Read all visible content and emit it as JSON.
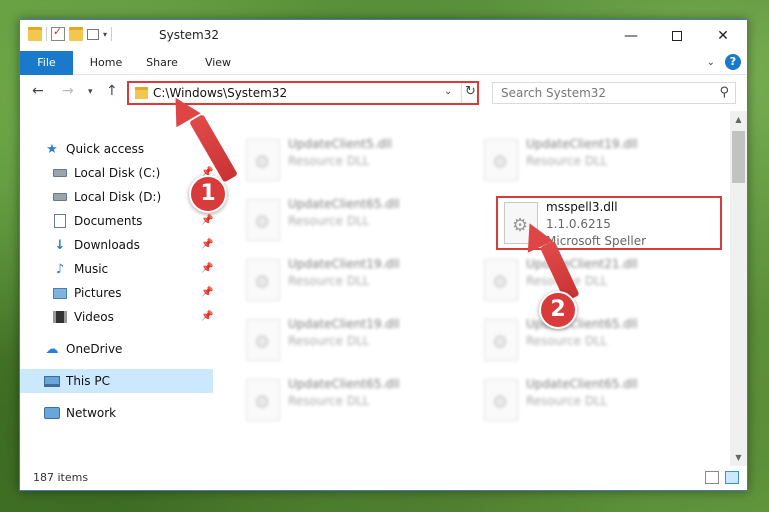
{
  "window": {
    "title": "System32",
    "controls": {
      "minimize": "—",
      "close": "✕"
    }
  },
  "ribbon": {
    "tabs": [
      "File",
      "Home",
      "Share",
      "View"
    ]
  },
  "address": {
    "path": "C:\\Windows\\System32",
    "search_placeholder": "Search System32"
  },
  "nav": {
    "quick_access": "Quick access",
    "items": [
      {
        "label": "Local Disk (C:)",
        "icon": "disk-icon",
        "pinned": true
      },
      {
        "label": "Local Disk (D:)",
        "icon": "disk-icon",
        "pinned": false
      },
      {
        "label": "Documents",
        "icon": "documents-icon",
        "pinned": true
      },
      {
        "label": "Downloads",
        "icon": "download-icon",
        "pinned": true
      },
      {
        "label": "Music",
        "icon": "music-icon",
        "pinned": true
      },
      {
        "label": "Pictures",
        "icon": "pictures-icon",
        "pinned": true
      },
      {
        "label": "Videos",
        "icon": "videos-icon",
        "pinned": true
      }
    ],
    "onedrive": "OneDrive",
    "this_pc": "This PC",
    "network": "Network"
  },
  "files": [
    {
      "name": "UpdateClient5.dll",
      "desc": "Resource DLL"
    },
    {
      "name": "UpdateClient19.dll",
      "desc": "Resource DLL"
    },
    {
      "name": "UpdateClient65.dll",
      "desc": "Resource DLL"
    },
    {
      "name": "msspell3.dll",
      "version": "1.1.0.6215",
      "desc": "Microsoft Speller",
      "highlighted": true
    },
    {
      "name": "UpdateClient19.dll",
      "desc": "Resource DLL"
    },
    {
      "name": "UpdateClient21.dll",
      "desc": "Resource DLL"
    },
    {
      "name": "UpdateClient19.dll",
      "desc": "Resource DLL"
    },
    {
      "name": "UpdateClient65.dll",
      "desc": "Resource DLL"
    },
    {
      "name": "UpdateClient65.dll",
      "desc": "Resource DLL"
    },
    {
      "name": "UpdateClient65.dll",
      "desc": "Resource DLL"
    }
  ],
  "status": {
    "item_count": "187 items"
  },
  "annotations": {
    "step1": "1",
    "step2": "2",
    "color": "#d93a3a"
  }
}
